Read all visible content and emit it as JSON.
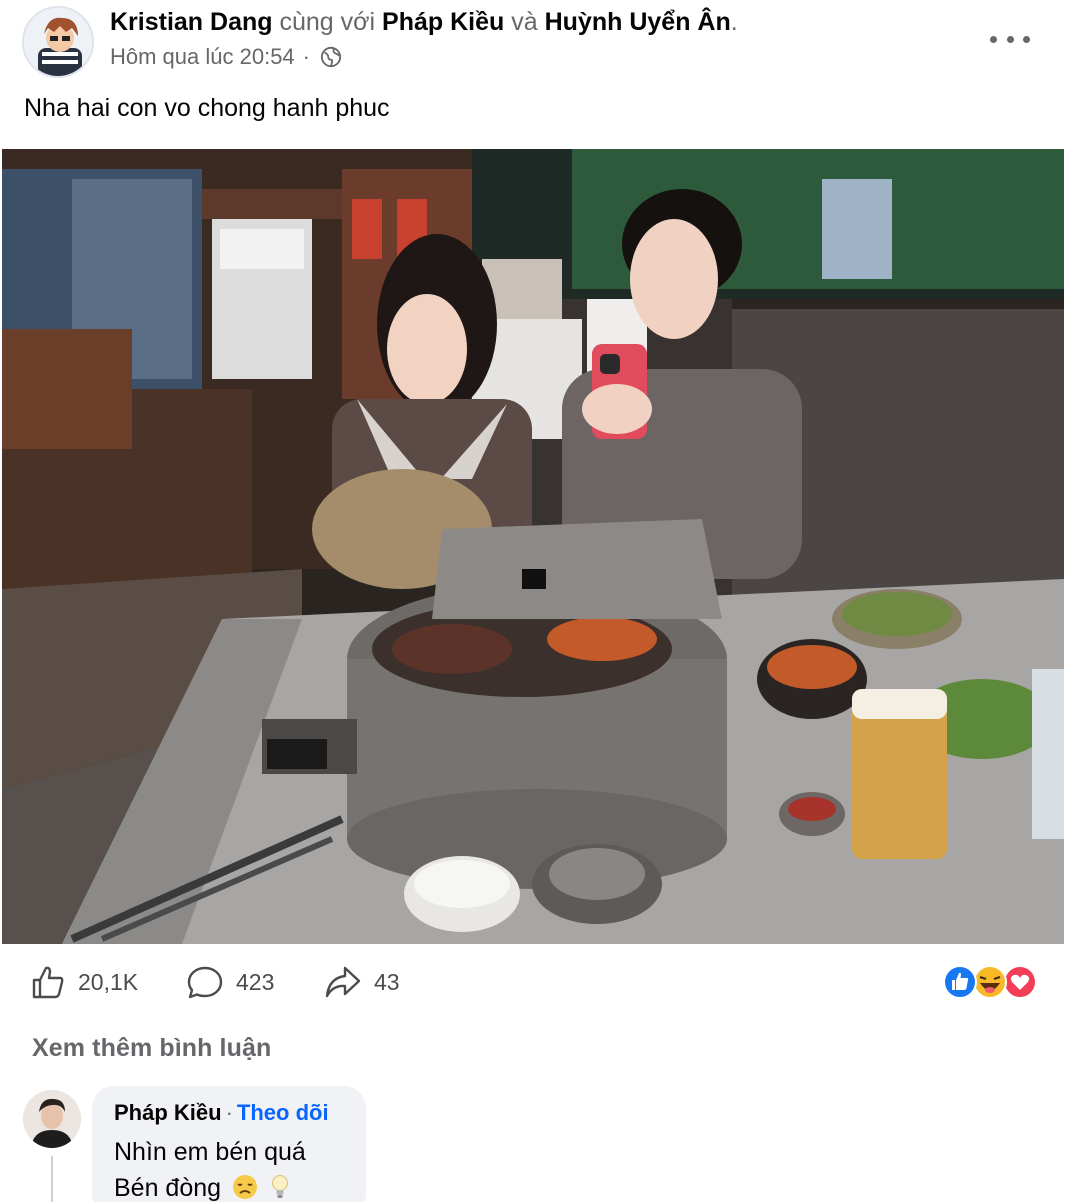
{
  "post": {
    "author": "Kristian Dang",
    "with_text": "cùng với",
    "tagged_1": "Pháp Kiều",
    "and_text": "và",
    "tagged_2": "Huỳnh Uyển Ân",
    "period": ".",
    "timestamp": "Hôm qua lúc 20:54",
    "separator": "·",
    "audience_icon": "globe-icon",
    "caption": "Nha hai con vo chong hanh phuc"
  },
  "stats": {
    "likes": "20,1K",
    "comments": "423",
    "shares": "43",
    "reaction_icons": [
      "like-reaction-icon",
      "haha-reaction-icon",
      "love-reaction-icon"
    ]
  },
  "comments_section": {
    "see_more": "Xem thêm bình luận",
    "comment": {
      "author": "Pháp Kiều",
      "separator": "·",
      "follow_label": "Theo dõi",
      "line1": "Nhìn em bén quá",
      "line2": "Bén đòng"
    }
  },
  "colors": {
    "link_blue": "#0866ff",
    "secondary_text": "#65676b",
    "bubble_bg": "#f0f2f5",
    "love_red": "#f33e58",
    "like_blue": "#1877f2",
    "haha_yellow": "#f7b928"
  }
}
